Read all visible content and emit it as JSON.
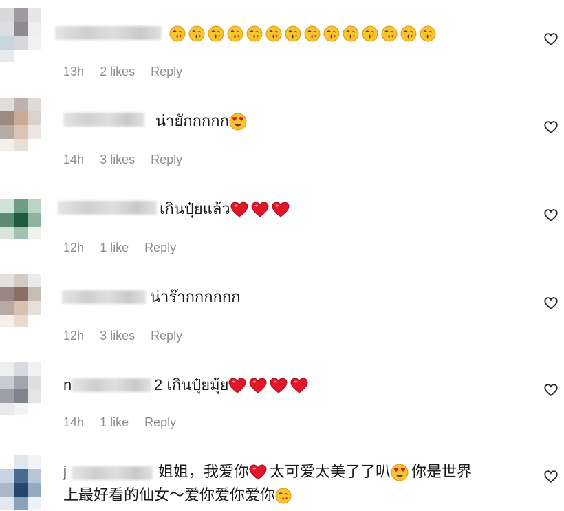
{
  "comments": [
    {
      "text": "",
      "time": "13h",
      "likes": "2 likes",
      "reply": "Reply",
      "emoji": [
        "kissing",
        "kissing",
        "kissing",
        "kissing",
        "kissing",
        "kissing",
        "kissing",
        "kissing",
        "kissing",
        "kissing",
        "kissing",
        "kissing",
        "kissing",
        "kissing"
      ]
    },
    {
      "text": "น่ายักกกกก",
      "time": "14h",
      "likes": "3 likes",
      "reply": "Reply",
      "emoji": [
        "heart-eyes"
      ]
    },
    {
      "text": "เกินปุ๋ยแล้ว",
      "time": "12h",
      "likes": "1 like",
      "reply": "Reply",
      "emoji": [
        "red-heart",
        "red-heart",
        "red-heart"
      ]
    },
    {
      "text": "น่าร๊ากกกกกก",
      "time": "12h",
      "likes": "3 likes",
      "reply": "Reply",
      "emoji": []
    },
    {
      "text_prefix": "n",
      "text": "2 เกินปุ๋ยมุ้ย",
      "time": "14h",
      "likes": "1 like",
      "reply": "Reply",
      "emoji": [
        "red-heart",
        "red-heart",
        "red-heart",
        "red-heart"
      ]
    },
    {
      "text_prefix": "j",
      "text_part1": "姐姐，我爱你",
      "text_part2": "太可爱太美了了叭",
      "text_part3": "你是世界",
      "text_line2": "上最好看的仙女～爱你爱你爱你",
      "emoji": [
        "red-heart",
        "heart-eyes",
        "kissing"
      ]
    }
  ],
  "icons": {
    "like": "heart-outline-icon"
  },
  "colors": {
    "meta": "#8e8e8e",
    "text": "#1a1a1a",
    "heart": "#e0162b",
    "emoji_face": "#f7c331"
  }
}
